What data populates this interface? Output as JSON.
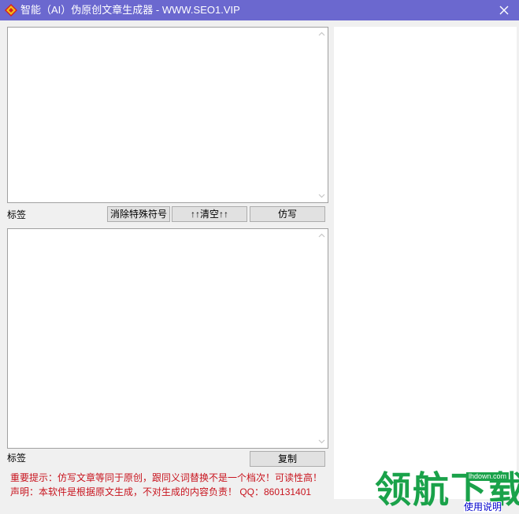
{
  "window": {
    "title": "智能（AI）伪原创文章生成器 - WWW.SEO1.VIP",
    "icon": "app-diamond-icon",
    "close_icon": "close-icon"
  },
  "top_section": {
    "input_value": "",
    "label": "标签",
    "buttons": {
      "remove_special": "消除特殊符号",
      "clear": "↑↑清空↑↑",
      "rewrite": "仿写"
    }
  },
  "bottom_section": {
    "output_value": "",
    "label": "标签",
    "buttons": {
      "copy": "复制"
    }
  },
  "notices": {
    "tip": "重要提示：仿写文章等同于原创，跟同义词替换不是一个档次！可读性高！",
    "disclaimer": "声明：本软件是根据原文生成，不对生成的内容负责！ QQ：860131401"
  },
  "watermark": {
    "logo_text": "领航下载",
    "domain": "lhdown.com"
  },
  "help_link": "使用说明",
  "colors": {
    "titlebar": "#6b68cf",
    "notice_red": "#c8141e",
    "watermark_green": "#1aa24a",
    "link_blue": "#0000cc"
  }
}
